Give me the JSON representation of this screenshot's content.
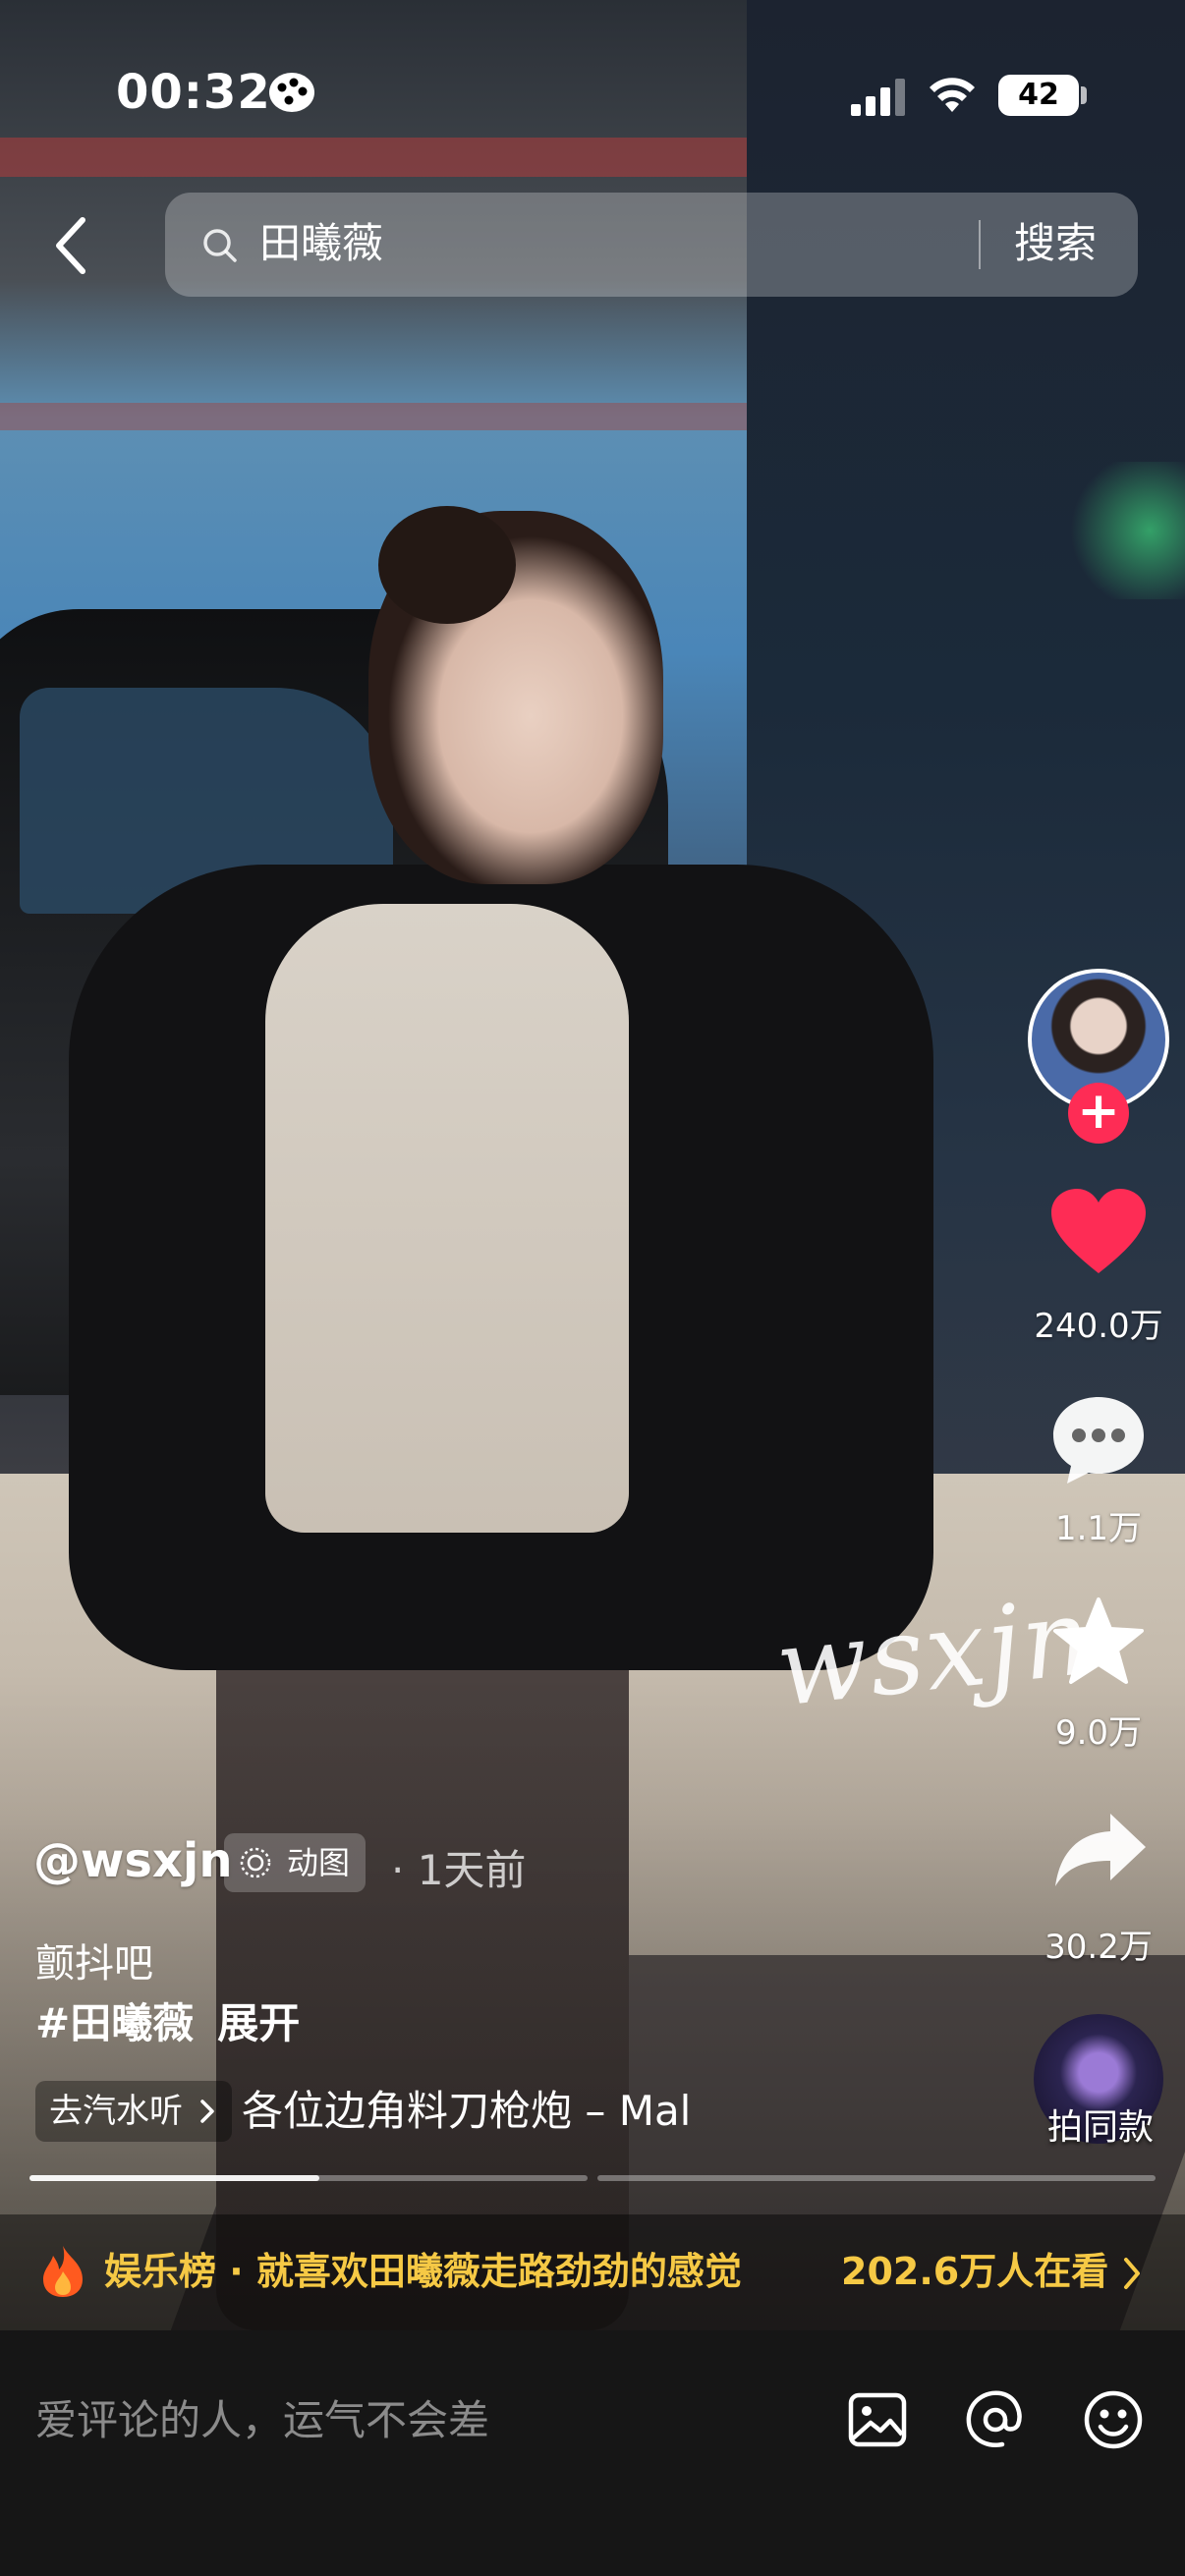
{
  "status_bar": {
    "time": "00:32",
    "battery": "42"
  },
  "search": {
    "query": "田曦薇",
    "button_label": "搜索"
  },
  "author": {
    "username": "@wsxjn",
    "badge_label": "动图",
    "time_ago": "· 1天前"
  },
  "caption": {
    "text": "颤抖吧",
    "hashtag": "#田曦薇",
    "expand_label": "展开"
  },
  "music": {
    "chip_label": "去汽水听",
    "title": "各位边角料刀枪炮 – Mal"
  },
  "actions": {
    "likes": "240.0万",
    "comments": "1.1万",
    "favorites": "9.0万",
    "shares": "30.2万",
    "remix_label": "拍同款"
  },
  "watermark": "wsxjn",
  "progress": {
    "played_fraction": 0.52
  },
  "hot_banner": {
    "text": "娱乐榜 · 就喜欢田曦薇走路劲劲的感觉",
    "viewers": "202.6万人在看"
  },
  "comment_bar": {
    "placeholder": "爱评论的人，运气不会差"
  },
  "colors": {
    "like_red": "#fe2c55",
    "banner_gold": "#f6c945"
  },
  "icons": [
    "back-icon",
    "search-icon",
    "heart-icon",
    "comment-icon",
    "star-icon",
    "share-icon",
    "image-icon",
    "at-icon",
    "emoji-icon",
    "fire-icon"
  ]
}
